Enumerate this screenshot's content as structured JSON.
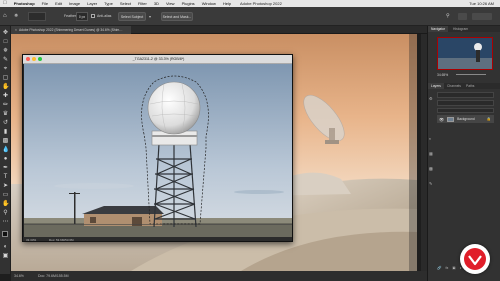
{
  "menubar": {
    "app_name": "Photoshop",
    "items": [
      "File",
      "Edit",
      "Image",
      "Layer",
      "Type",
      "Select",
      "Filter",
      "3D",
      "View",
      "Plugins",
      "Window",
      "Help"
    ],
    "window_title": "Adobe Photoshop 2022",
    "clock": "Tue 10:26 AM"
  },
  "options": {
    "feather_label": "Feather:",
    "feather_value": "0 px",
    "antialias_label": "Anti-alias",
    "select_subject": "Select Subject",
    "select_mask": "Select and Mask..."
  },
  "doc_tabs": [
    {
      "label": "Adobe Photoshop 2022 (Shimmering Desert Dunes) @ 34.6% (Shimmering_Sand_Dunes, Layer Mask/8) *"
    }
  ],
  "float_window": {
    "title": "_TGA2311-2 @ 33.3% (RGB/8*)",
    "zoom": "33.33%",
    "doc_size": "Doc: 53.6M/53.6M"
  },
  "status": {
    "zoom": "34.6%",
    "doc_size": "Doc: 79.6M/155.5M"
  },
  "navigator": {
    "tabs": [
      "Navigator",
      "Histogram"
    ],
    "zoom": "34.65%"
  },
  "layers": {
    "tabs": [
      "Layers",
      "Channels",
      "Paths"
    ],
    "layer_name": "Background"
  },
  "colors": {
    "accent": "#e01e2a",
    "sky_top": "#8fa6bd",
    "sky_bottom": "#dbe3ea"
  }
}
